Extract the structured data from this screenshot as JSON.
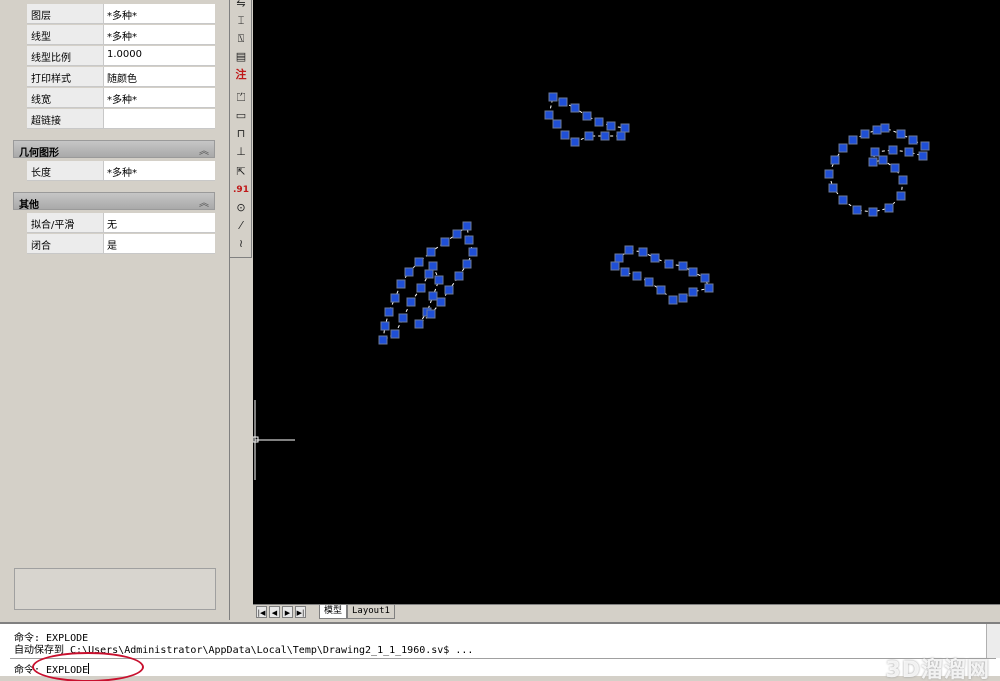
{
  "properties": {
    "general_rows": [
      {
        "name": "图层",
        "value": "*多种*"
      },
      {
        "name": "线型",
        "value": "*多种*"
      },
      {
        "name": "线型比例",
        "value": "1.0000"
      },
      {
        "name": "打印样式",
        "value": "随颜色"
      },
      {
        "name": "线宽",
        "value": "*多种*"
      },
      {
        "name": "超链接",
        "value": ""
      }
    ],
    "geometry": {
      "title": "几何图形",
      "rows": [
        {
          "name": "长度",
          "value": "*多种*"
        }
      ]
    },
    "misc": {
      "title": "其他",
      "rows": [
        {
          "name": "拟合/平滑",
          "value": "无"
        },
        {
          "name": "闭合",
          "value": "是"
        }
      ]
    }
  },
  "toolbar_icons": [
    "dimension-icon",
    "ordinate-icon",
    "baseline-icon",
    "continue-icon",
    "annotation-icon",
    "arc-length-icon",
    "radius-icon",
    "linear-icon",
    "aligned-icon",
    "leader-icon",
    "decimal-icon",
    "center-mark-icon",
    "oblique-icon",
    "break-icon"
  ],
  "toolbar_glyphs": {
    "annotation": "注",
    "decimal": ".91"
  },
  "tabs": {
    "model": "模型",
    "layout1": "Layout1"
  },
  "command_line": {
    "line1": "命令: EXPLODE",
    "line2": "自动保存到 C:\\Users\\Administrator\\AppData\\Local\\Temp\\Drawing2_1_1_1960.sv$ ...",
    "input": "命令: EXPLODE"
  },
  "watermark": "3D溜溜网",
  "colors": {
    "canvas": "#000000",
    "selected_grip": "#1f4fd6",
    "highlight_circle": "#c8102e"
  }
}
